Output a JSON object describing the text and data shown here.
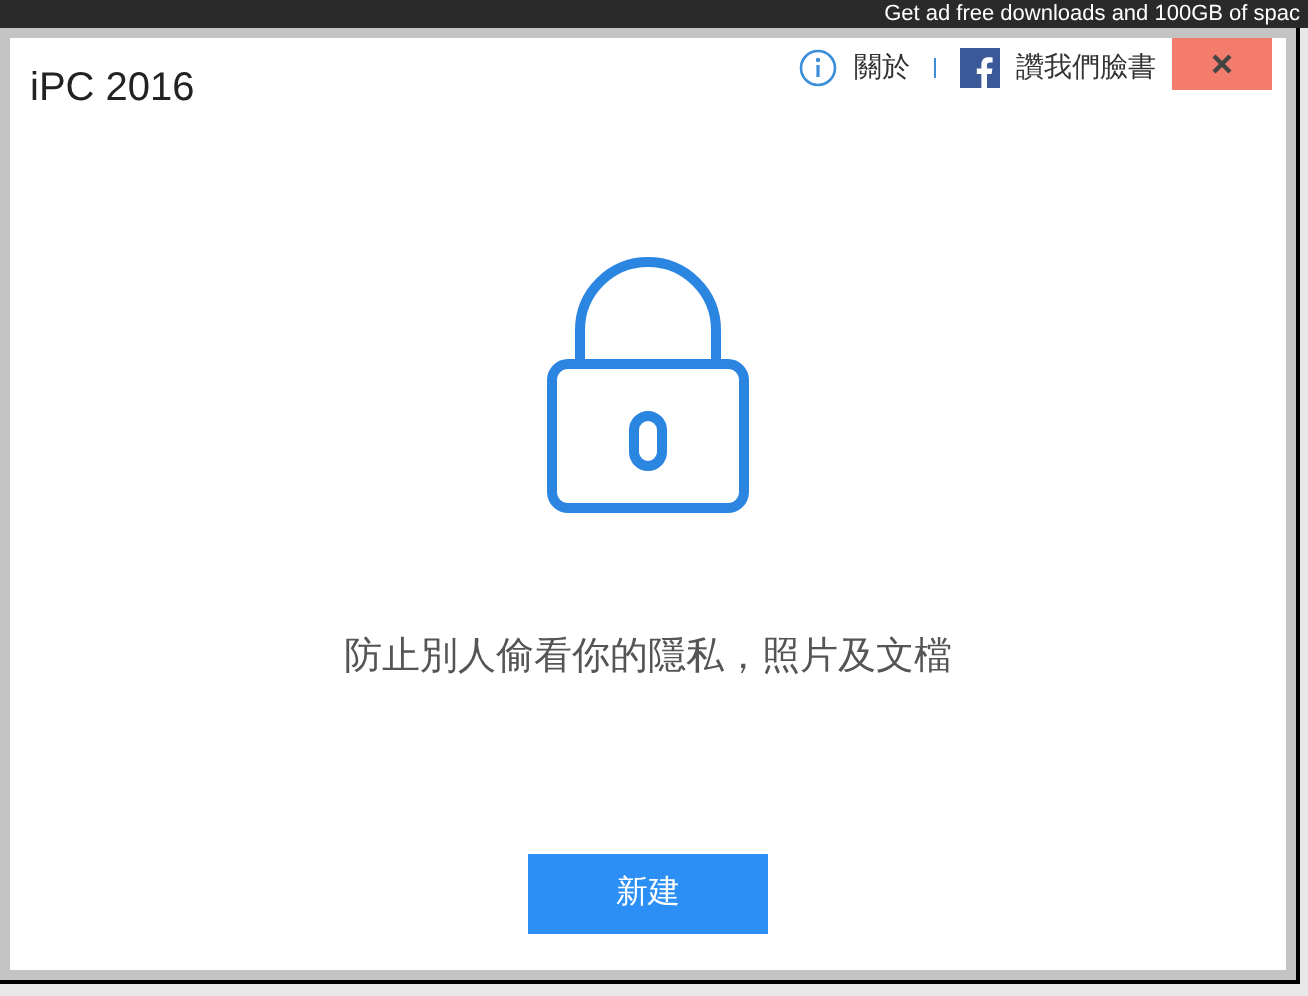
{
  "background": {
    "banner_text": "Get ad free downloads and 100GB of spac"
  },
  "window": {
    "title": "iPC 2016",
    "about": "關於",
    "facebook": "讚我們臉書"
  },
  "message": "防止別人偷看你的隱私，照片及文檔",
  "buttons": [
    "新建"
  ]
}
